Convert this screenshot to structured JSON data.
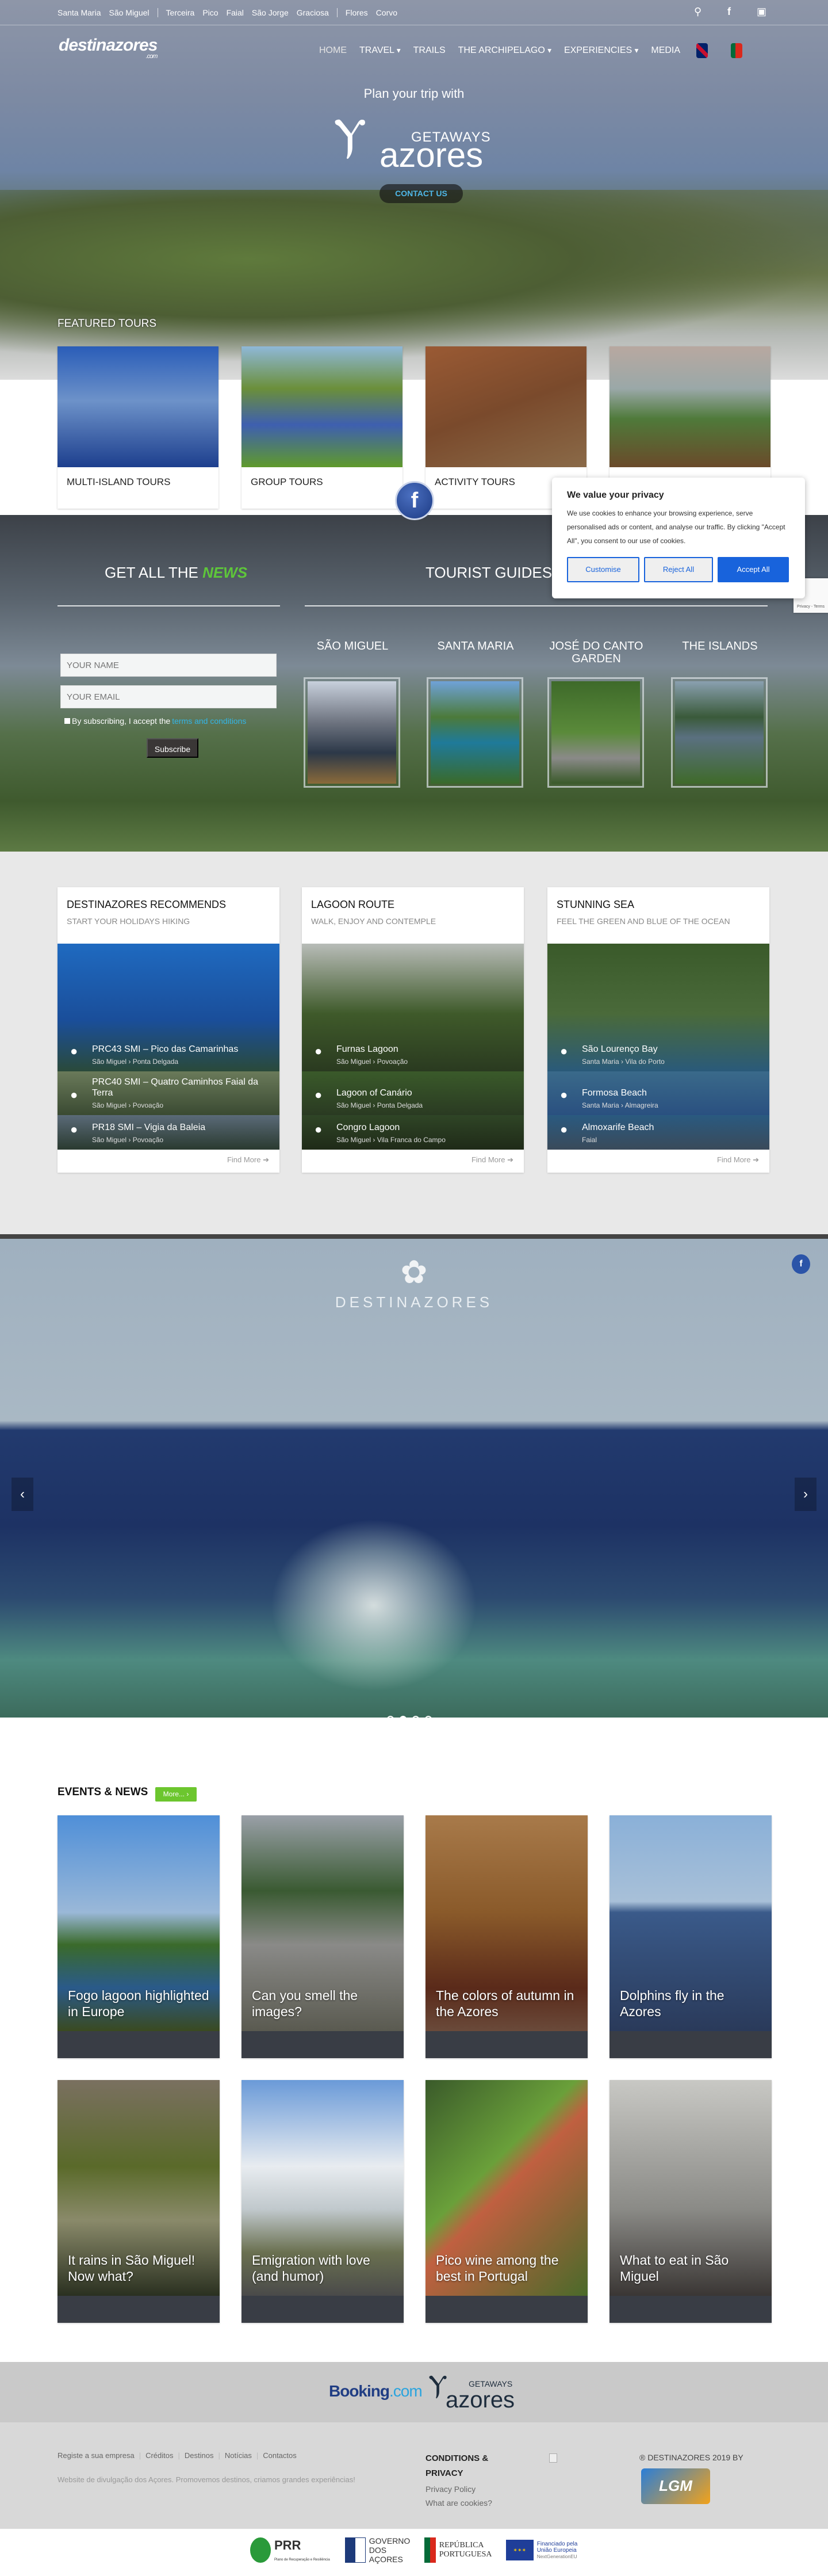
{
  "topbar": {
    "islands": [
      "Santa Maria",
      "São Miguel",
      "Terceira",
      "Pico",
      "Faial",
      "São Jorge",
      "Graciosa",
      "Flores",
      "Corvo"
    ],
    "icons": [
      "search-icon",
      "facebook-icon",
      "instagram-icon"
    ]
  },
  "nav": {
    "logo": "destinazores",
    "logo_sub": ".com",
    "items": [
      "HOME",
      "TRAVEL",
      "TRAILS",
      "THE ARCHIPELAGO",
      "EXPERIENCIES",
      "MEDIA"
    ],
    "languages": [
      "English",
      "Português"
    ]
  },
  "hero": {
    "title": "Plan your trip with",
    "brand_top": "GETAWAYS",
    "brand": "azores",
    "cta": "CONTACT US"
  },
  "featured": {
    "heading": "FEATURED TOURS",
    "tours": [
      "MULTI-ISLAND TOURS",
      "GROUP TOURS",
      "ACTIVITY TOURS",
      ""
    ]
  },
  "newsletter": {
    "heading": "GET ALL THE",
    "heading_em": "NEWS",
    "name_placeholder": "YOUR NAME",
    "email_placeholder": "YOUR EMAIL",
    "consent": "By subscribing, I accept the",
    "consent_link": "terms and conditions",
    "subscribe": "Subscribe"
  },
  "guides": {
    "heading": "TOURIST GUIDES",
    "heading_em": "D",
    "items": [
      "SÃO MIGUEL",
      "SANTA MARIA",
      "JOSÉ DO CANTO GARDEN",
      "THE ISLANDS"
    ]
  },
  "cookie": {
    "title": "We value your privacy",
    "text": "We use cookies to enhance your browsing experience, serve personalised ads or content, and analyse our traffic. By clicking \"Accept All\", you consent to our use of cookies.",
    "customise": "Customise",
    "reject": "Reject All",
    "accept": "Accept All",
    "recaptcha": "Privacy - Terms",
    "accent": "#1863dc"
  },
  "recommendations": [
    {
      "title": "DESTINAZORES RECOMMENDS",
      "subtitle": "START YOUR HOLIDAYS HIKING",
      "items": [
        {
          "name": "PRC43 SMI – Pico das Camarinhas",
          "loc": "São Miguel › Ponta Delgada"
        },
        {
          "name": "PRC40 SMI – Quatro Caminhos Faial da Terra",
          "loc": "São Miguel › Povoação"
        },
        {
          "name": "PR18 SMI – Vigia da Baleia",
          "loc": "São Miguel › Povoação"
        }
      ],
      "more": "Find More"
    },
    {
      "title": "LAGOON ROUTE",
      "subtitle": "WALK, ENJOY AND CONTEMPLE",
      "items": [
        {
          "name": "Furnas Lagoon",
          "loc": "São Miguel › Povoação"
        },
        {
          "name": "Lagoon of Canário",
          "loc": "São Miguel › Ponta Delgada"
        },
        {
          "name": "Congro Lagoon",
          "loc": "São Miguel › Vila Franca do Campo"
        }
      ],
      "more": "Find More"
    },
    {
      "title": "STUNNING SEA",
      "subtitle": "FEEL THE GREEN AND BLUE OF THE OCEAN",
      "items": [
        {
          "name": "São Lourenço Bay",
          "loc": "Santa Maria › Vila do Porto"
        },
        {
          "name": "Formosa Beach",
          "loc": "Santa Maria › Almagreira"
        },
        {
          "name": "Almoxarife Beach",
          "loc": "Faial"
        }
      ],
      "more": "Find More"
    }
  ],
  "slider": {
    "brand": "DESTINAZORES",
    "slides": 4,
    "active": 2
  },
  "events": {
    "heading": "EVENTS & NEWS",
    "more": "More... ›",
    "items": [
      "Fogo lagoon highlighted in Europe",
      "Can you smell the images?",
      "The colors of autumn in the Azores",
      "Dolphins fly in the Azores",
      "It rains in São Miguel! Now what?",
      "Emigration with love (and humor)",
      "Pico wine among the best in Portugal",
      "What to eat in São Miguel"
    ]
  },
  "partners": {
    "booking": "Booking",
    "booking_tld": ".com",
    "getaways": "GETAWAYS",
    "azores": "azores"
  },
  "footer": {
    "links": [
      "Registe a sua empresa",
      "Créditos",
      "Destinos",
      "Notícias",
      "Contactos"
    ],
    "tagline": "Website de divulgação dos Açores. Promovemos destinos, criamos grandes experiências!",
    "conditions_title": "CONDITIONS & PRIVACY",
    "privacy": "Privacy Policy",
    "cookies": "What are cookies?",
    "copyright": "® DESTINAZORES 2019 BY",
    "dev_logo": "LGM"
  },
  "sponsors": {
    "prr": "PRR",
    "prr_sub": "Plano de Recuperação e Resiliência",
    "gov": "GOVERNO DOS AÇORES",
    "rep": "REPÚBLICA PORTUGUESA",
    "eu": "Financiado pela União Europeia",
    "eu_sub": "NextGenerationEU"
  }
}
